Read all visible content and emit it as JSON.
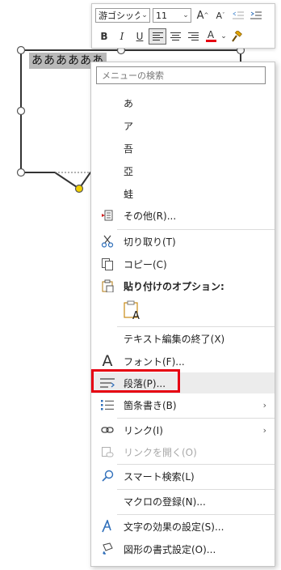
{
  "shape": {
    "text": "ああああああ"
  },
  "mini_toolbar": {
    "font_name": "游ゴシック",
    "font_size": "11",
    "buttons": {
      "grow_font": "A",
      "shrink_font": "A",
      "bold": "B",
      "italic": "I",
      "underline": "U",
      "font_color": "A"
    },
    "font_color_value": "#e60012"
  },
  "context_menu": {
    "search_placeholder": "メニューの検索",
    "candidates": [
      "あ",
      "ア",
      "吾",
      "亞",
      "蛙"
    ],
    "other": "その他(R)...",
    "cut": "切り取り(T)",
    "copy": "コピー(C)",
    "paste_options": "貼り付けのオプション:",
    "exit_text_edit": "テキスト編集の終了(X)",
    "font": "フォント(F)...",
    "paragraph": "段落(P)...",
    "bullets": "箇条書き(B)",
    "link": "リンク(I)",
    "open_link": "リンクを開く(O)",
    "smart_lookup": "スマート検索(L)",
    "assign_macro": "マクロの登録(N)...",
    "text_effects": "文字の効果の設定(S)...",
    "format_shape": "図形の書式設定(O)..."
  },
  "highlight_color": "#e60012"
}
